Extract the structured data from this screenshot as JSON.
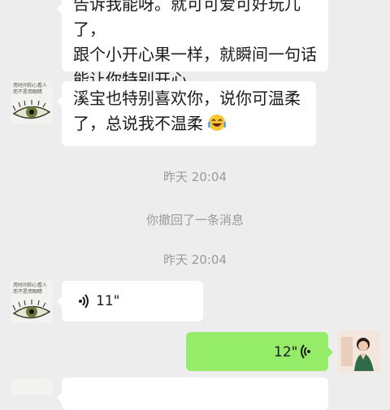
{
  "messages": [
    {
      "lines": [
        "告诉我能呀。就可可爱可好玩儿了，",
        "跟个小开心果一样，就瞬间一句话",
        "能让你特别开心。"
      ]
    },
    {
      "lines": [
        "溪宝也特别喜欢你，说你可温柔",
        "了，总说我不温柔"
      ],
      "emoji": "laughing-crying-emoji"
    },
    {
      "timestamp": "昨天 20:04"
    },
    {
      "system": "你撤回了一条消息"
    },
    {
      "timestamp": "昨天 20:04"
    },
    {
      "voice_duration": "11\""
    },
    {
      "voice_duration": "12\""
    }
  ],
  "avatar_caption": [
    "用时间和心看人",
    "而不是用眼睛"
  ],
  "colors": {
    "background": "#ededed",
    "incoming_bubble": "#ffffff",
    "outgoing_bubble": "#95ec69",
    "timestamp_text": "#9a9a9a"
  }
}
